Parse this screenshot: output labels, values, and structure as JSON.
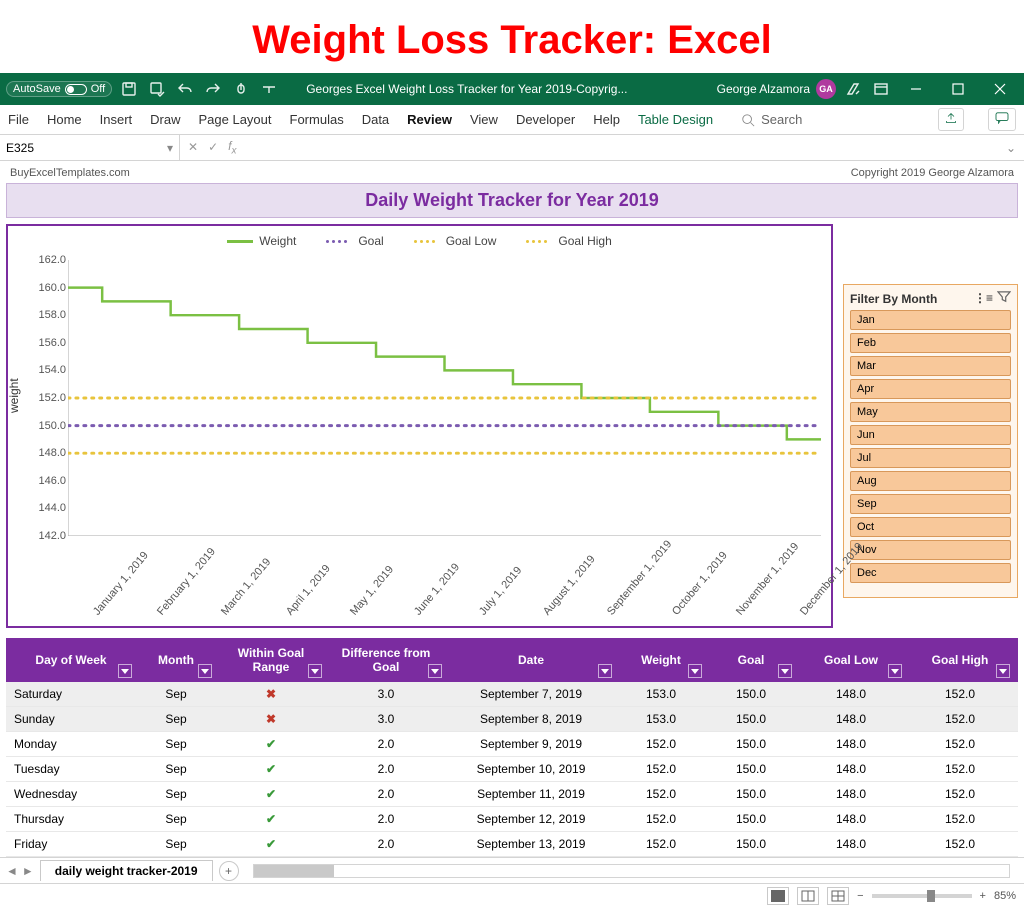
{
  "page_heading": "Weight Loss Tracker: Excel",
  "titlebar": {
    "autosave_label": "AutoSave",
    "autosave_state": "Off",
    "doc_title": "Georges Excel Weight Loss Tracker for Year 2019-Copyrig...",
    "user_name": "George Alzamora",
    "user_initials": "GA"
  },
  "ribbon": {
    "tabs": [
      "File",
      "Home",
      "Insert",
      "Draw",
      "Page Layout",
      "Formulas",
      "Data",
      "Review",
      "View",
      "Developer",
      "Help"
    ],
    "context_tab": "Table Design",
    "active_tab": "Review",
    "search_placeholder": "Search"
  },
  "formula_bar": {
    "namebox": "E325",
    "formula": ""
  },
  "sheet_meta": {
    "left": "BuyExcelTemplates.com",
    "right": "Copyright 2019  George Alzamora"
  },
  "sheet_title": "Daily Weight Tracker for Year 2019",
  "legend": {
    "weight": "Weight",
    "goal": "Goal",
    "goal_low": "Goal Low",
    "goal_high": "Goal High"
  },
  "chart_data": {
    "type": "line",
    "ylabel": "weight",
    "ylim": [
      142,
      162
    ],
    "yticks": [
      142.0,
      144.0,
      146.0,
      148.0,
      150.0,
      152.0,
      154.0,
      156.0,
      158.0,
      160.0,
      162.0
    ],
    "x_categories": [
      "January 1, 2019",
      "February 1, 2019",
      "March 1, 2019",
      "April 1, 2019",
      "May 1, 2019",
      "June 1, 2019",
      "July 1, 2019",
      "August 1, 2019",
      "September 1, 2019",
      "October 1, 2019",
      "November 1, 2019",
      "December 1, 2019"
    ],
    "series": [
      {
        "name": "Weight",
        "style": "solid",
        "color": "#7bc043",
        "values": [
          160.0,
          159.0,
          158.0,
          157.0,
          156.0,
          155.0,
          154.0,
          153.0,
          152.0,
          151.0,
          150.0,
          149.0
        ]
      },
      {
        "name": "Goal",
        "style": "dotted",
        "color": "#7b5bb0",
        "values": [
          150.0,
          150.0,
          150.0,
          150.0,
          150.0,
          150.0,
          150.0,
          150.0,
          150.0,
          150.0,
          150.0,
          150.0
        ]
      },
      {
        "name": "Goal Low",
        "style": "dotted",
        "color": "#e8c43c",
        "values": [
          148.0,
          148.0,
          148.0,
          148.0,
          148.0,
          148.0,
          148.0,
          148.0,
          148.0,
          148.0,
          148.0,
          148.0
        ]
      },
      {
        "name": "Goal High",
        "style": "dotted",
        "color": "#e8c43c",
        "values": [
          152.0,
          152.0,
          152.0,
          152.0,
          152.0,
          152.0,
          152.0,
          152.0,
          152.0,
          152.0,
          152.0,
          152.0
        ]
      }
    ]
  },
  "slicer": {
    "title": "Filter By Month",
    "items": [
      "Jan",
      "Feb",
      "Mar",
      "Apr",
      "May",
      "Jun",
      "Jul",
      "Aug",
      "Sep",
      "Oct",
      "Nov",
      "Dec"
    ]
  },
  "table": {
    "headers": [
      "Day of Week",
      "Month",
      "Within Goal Range",
      "Difference from Goal",
      "Date",
      "Weight",
      "Goal",
      "Goal Low",
      "Goal High"
    ],
    "rows": [
      {
        "dow": "Saturday",
        "mon": "Sep",
        "wgr": false,
        "diff": "3.0",
        "date": "September 7, 2019",
        "w": "153.0",
        "g": "150.0",
        "gl": "148.0",
        "gh": "152.0"
      },
      {
        "dow": "Sunday",
        "mon": "Sep",
        "wgr": false,
        "diff": "3.0",
        "date": "September 8, 2019",
        "w": "153.0",
        "g": "150.0",
        "gl": "148.0",
        "gh": "152.0"
      },
      {
        "dow": "Monday",
        "mon": "Sep",
        "wgr": true,
        "diff": "2.0",
        "date": "September 9, 2019",
        "w": "152.0",
        "g": "150.0",
        "gl": "148.0",
        "gh": "152.0"
      },
      {
        "dow": "Tuesday",
        "mon": "Sep",
        "wgr": true,
        "diff": "2.0",
        "date": "September 10, 2019",
        "w": "152.0",
        "g": "150.0",
        "gl": "148.0",
        "gh": "152.0"
      },
      {
        "dow": "Wednesday",
        "mon": "Sep",
        "wgr": true,
        "diff": "2.0",
        "date": "September 11, 2019",
        "w": "152.0",
        "g": "150.0",
        "gl": "148.0",
        "gh": "152.0"
      },
      {
        "dow": "Thursday",
        "mon": "Sep",
        "wgr": true,
        "diff": "2.0",
        "date": "September 12, 2019",
        "w": "152.0",
        "g": "150.0",
        "gl": "148.0",
        "gh": "152.0"
      },
      {
        "dow": "Friday",
        "mon": "Sep",
        "wgr": true,
        "diff": "2.0",
        "date": "September 13, 2019",
        "w": "152.0",
        "g": "150.0",
        "gl": "148.0",
        "gh": "152.0"
      }
    ]
  },
  "sheet_tab": "daily weight tracker-2019",
  "zoom": "85%"
}
